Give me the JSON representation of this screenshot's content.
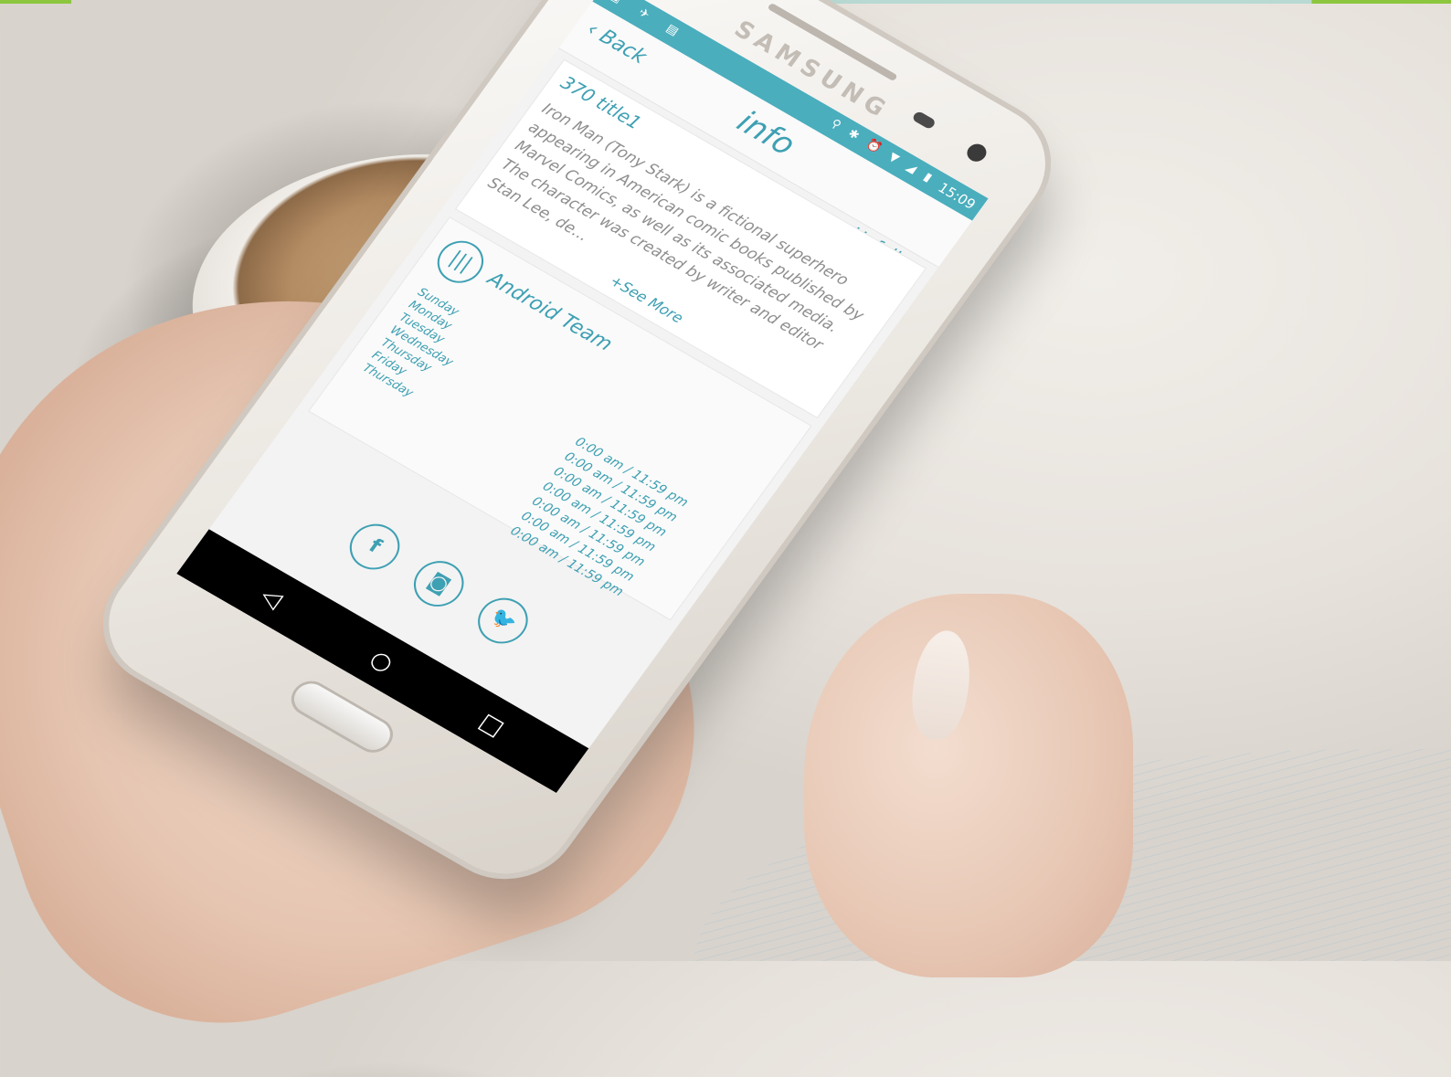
{
  "status_bar": {
    "time": "15:09",
    "left_icons": [
      "image-icon",
      "signal-icon",
      "sd-card-icon"
    ],
    "right_icons": [
      "location-icon",
      "bluetooth-icon",
      "alarm-icon",
      "wifi-icon",
      "cell-signal-icon",
      "battery-icon"
    ]
  },
  "header": {
    "back_label": "Back",
    "title": "info",
    "unfollow_label": "Unfollow"
  },
  "about": {
    "title": "370 title1",
    "description": "Iron Man (Tony Stark) is a fictional superhero appearing in American comic books published by Marvel Comics, as well as its associated media. The character was created by writer and editor Stan Lee, de...",
    "see_more": "+See More"
  },
  "team": {
    "icon": "sound-bars-icon",
    "name": "Android Team",
    "days": [
      "Sunday",
      "Monday",
      "Tuesday",
      "Wednesday",
      "Thursday",
      "Friday",
      "Thursday"
    ],
    "hours": [
      "0:00 am / 11:59 pm",
      "0:00 am / 11:59 pm",
      "0:00 am / 11:59 pm",
      "0:00 am / 11:59 pm",
      "0:00 am / 11:59 pm",
      "0:00 am / 11:59 pm",
      "0:00 am / 11:59 pm"
    ]
  },
  "social": {
    "facebook": "f",
    "instagram": "◙",
    "twitter": "🐦"
  },
  "device": {
    "brand": "SAMSUNG"
  },
  "nav": {
    "back": "◁",
    "home": "○",
    "recents": "□"
  },
  "colors": {
    "accent": "#3ea0b3",
    "status_bar": "#4aaebd",
    "top_bar_green": "#8cc63f"
  }
}
